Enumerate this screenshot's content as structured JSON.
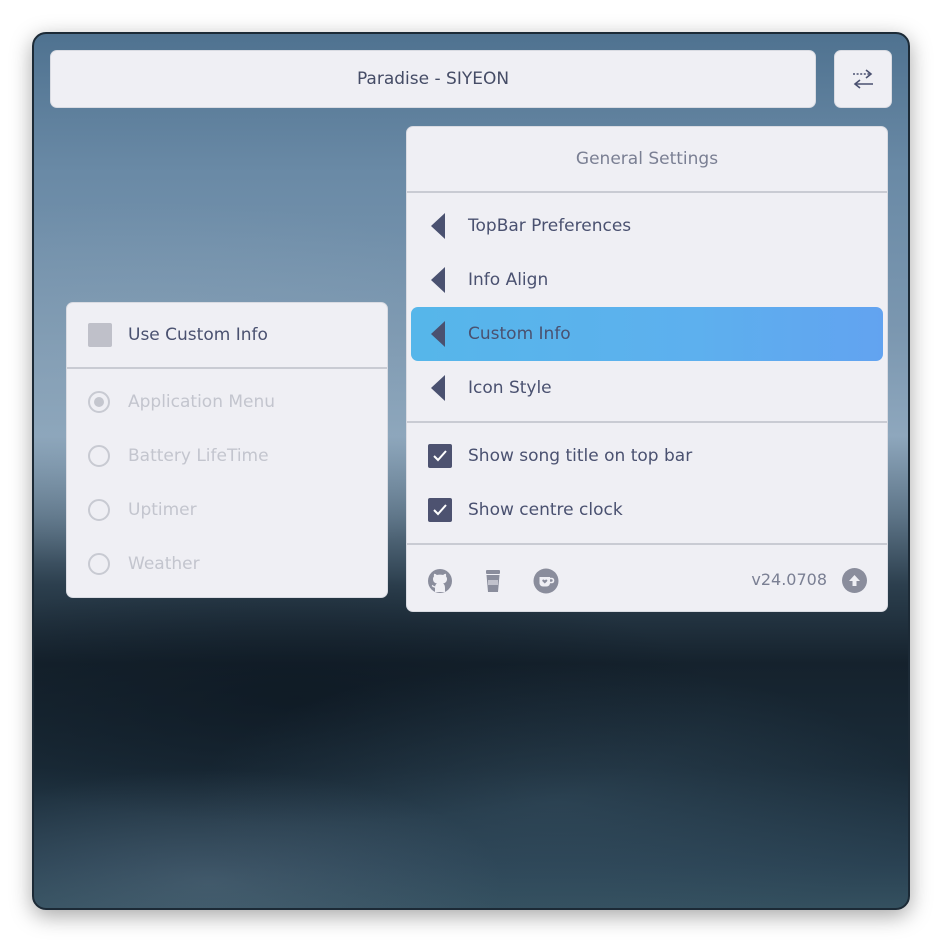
{
  "title_bar": {
    "title": "Paradise - SIYEON"
  },
  "swap_button": {
    "icon": "swap-arrows-icon"
  },
  "left_panel": {
    "use_custom_info": {
      "label": "Use Custom Info",
      "checked": false
    },
    "options": [
      {
        "label": "Application Menu",
        "selected": true
      },
      {
        "label": "Battery LifeTime",
        "selected": false
      },
      {
        "label": "Uptimer",
        "selected": false
      },
      {
        "label": "Weather",
        "selected": false
      }
    ]
  },
  "right_panel": {
    "header": "General Settings",
    "menu_items": [
      {
        "label": "TopBar Preferences",
        "icon": "arrow-left-icon"
      },
      {
        "label": "Info Align",
        "icon": "arrow-left-icon"
      },
      {
        "label": "Custom Info",
        "icon": "arrow-left-icon",
        "active": true
      },
      {
        "label": "Icon Style",
        "icon": "arrow-left-icon"
      }
    ],
    "toggles": [
      {
        "label": "Show song title on top bar",
        "checked": true
      },
      {
        "label": "Show centre clock",
        "checked": true
      }
    ],
    "footer": {
      "icons": [
        "github-icon",
        "coffee-cup-icon",
        "kofi-icon"
      ],
      "version": "v24.0708",
      "update_icon": "upload-arrow-icon"
    }
  },
  "colors": {
    "accent_gradient_start": "#56b6ea",
    "accent_gradient_end": "#62a3f0",
    "panel_bg": "#efeff4",
    "text": "#4a5170"
  }
}
